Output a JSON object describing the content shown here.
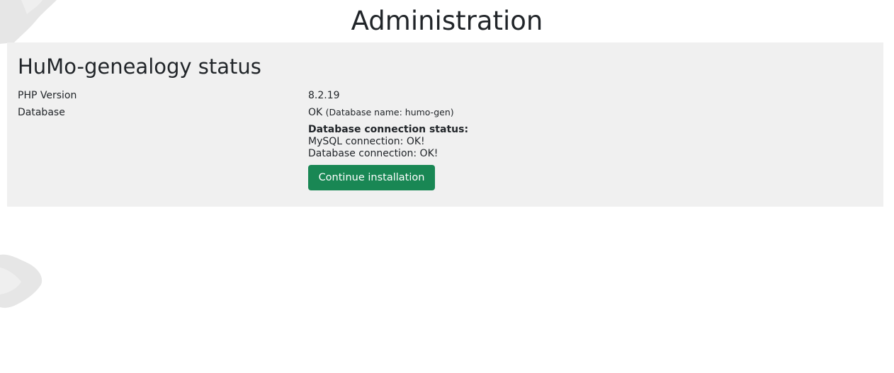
{
  "page": {
    "title": "Administration"
  },
  "status": {
    "title": "HuMo-genealogy status",
    "rows": [
      {
        "label": "PHP Version",
        "value": "8.2.19"
      },
      {
        "label": "Database",
        "value": "OK",
        "detail": "(Database name: humo-gen)"
      }
    ],
    "connection": {
      "heading": "Database connection status:",
      "lines": [
        "MySQL connection: OK!",
        "Database connection: OK!"
      ]
    },
    "continue_button_label": "Continue installation"
  },
  "colors": {
    "panel_background": "#f0f0f0",
    "button_background": "#198754",
    "button_text": "#ffffff"
  },
  "icons": {
    "background_decoration": "tree-bark-texture"
  }
}
